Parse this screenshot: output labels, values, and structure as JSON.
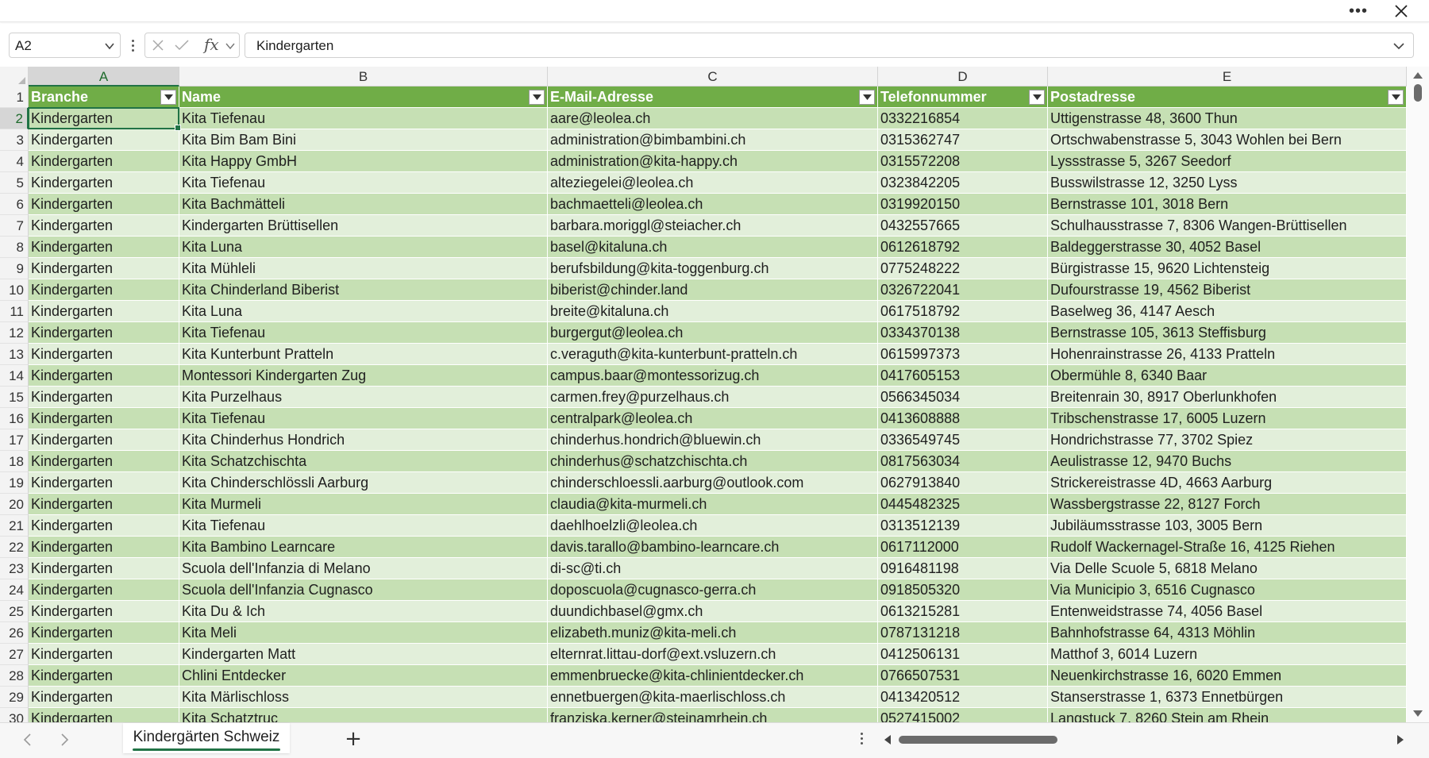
{
  "formula_bar": {
    "name_box": "A2",
    "formula": "Kindergarten"
  },
  "columns": [
    "A",
    "B",
    "C",
    "D",
    "E"
  ],
  "headers": [
    "Branche",
    "Name",
    "E-Mail-Adresse",
    "Telefonnummer",
    "Postadresse"
  ],
  "rows": [
    {
      "n": "2",
      "c": [
        "Kindergarten",
        "Kita Tiefenau",
        "aare@leolea.ch",
        "0332216854",
        "Uttigenstrasse 48, 3600 Thun"
      ]
    },
    {
      "n": "3",
      "c": [
        "Kindergarten",
        "Kita Bim Bam Bini",
        "administration@bimbambini.ch",
        "0315362747",
        "Ortschwabenstrasse 5, 3043 Wohlen bei Bern"
      ]
    },
    {
      "n": "4",
      "c": [
        "Kindergarten",
        "Kita Happy GmbH",
        "administration@kita-happy.ch",
        "0315572208",
        "Lyssstrasse 5, 3267 Seedorf"
      ]
    },
    {
      "n": "5",
      "c": [
        "Kindergarten",
        "Kita Tiefenau",
        "alteziegelei@leolea.ch",
        "0323842205",
        "Busswilstrasse 12, 3250 Lyss"
      ]
    },
    {
      "n": "6",
      "c": [
        "Kindergarten",
        "Kita Bachmätteli",
        "bachmaetteli@leolea.ch",
        "0319920150",
        "Bernstrasse 101, 3018 Bern"
      ]
    },
    {
      "n": "7",
      "c": [
        "Kindergarten",
        "Kindergarten Brüttisellen",
        "barbara.moriggl@steiacher.ch",
        "0432557665",
        "Schulhausstrasse 7, 8306 Wangen-Brüttisellen"
      ]
    },
    {
      "n": "8",
      "c": [
        "Kindergarten",
        "Kita Luna",
        "basel@kitaluna.ch",
        "0612618792",
        "Baldeggerstrasse 30, 4052 Basel"
      ]
    },
    {
      "n": "9",
      "c": [
        "Kindergarten",
        "Kita Mühleli",
        "berufsbildung@kita-toggenburg.ch",
        "0775248222",
        "Bürgistrasse 15, 9620 Lichtensteig"
      ]
    },
    {
      "n": "10",
      "c": [
        "Kindergarten",
        "Kita Chinderland Biberist",
        "biberist@chinder.land",
        "0326722041",
        "Dufourstrasse 19, 4562 Biberist"
      ]
    },
    {
      "n": "11",
      "c": [
        "Kindergarten",
        "Kita Luna",
        "breite@kitaluna.ch",
        "0617518792",
        "Baselweg 36, 4147 Aesch"
      ]
    },
    {
      "n": "12",
      "c": [
        "Kindergarten",
        "Kita Tiefenau",
        "burgergut@leolea.ch",
        "0334370138",
        "Bernstrasse 105, 3613 Steffisburg"
      ]
    },
    {
      "n": "13",
      "c": [
        "Kindergarten",
        "Kita Kunterbunt Pratteln",
        "c.veraguth@kita-kunterbunt-pratteln.ch",
        "0615997373",
        "Hohenrainstrasse 26, 4133 Pratteln"
      ]
    },
    {
      "n": "14",
      "c": [
        "Kindergarten",
        "Montessori Kindergarten Zug",
        "campus.baar@montessorizug.ch",
        "0417605153",
        "Obermühle 8, 6340 Baar"
      ]
    },
    {
      "n": "15",
      "c": [
        "Kindergarten",
        "Kita Purzelhaus",
        "carmen.frey@purzelhaus.ch",
        "0566345034",
        "Breitenrain 30, 8917 Oberlunkhofen"
      ]
    },
    {
      "n": "16",
      "c": [
        "Kindergarten",
        "Kita Tiefenau",
        "centralpark@leolea.ch",
        "0413608888",
        "Tribschenstrasse 17, 6005 Luzern"
      ]
    },
    {
      "n": "17",
      "c": [
        "Kindergarten",
        "Kita Chinderhus Hondrich",
        "chinderhus.hondrich@bluewin.ch",
        "0336549745",
        "Hondrichstrasse 77, 3702 Spiez"
      ]
    },
    {
      "n": "18",
      "c": [
        "Kindergarten",
        "Kita Schatzchischta",
        "chinderhus@schatzchischta.ch",
        "0817563034",
        "Aeulistrasse 12, 9470 Buchs"
      ]
    },
    {
      "n": "19",
      "c": [
        "Kindergarten",
        "Kita Chinderschlössli Aarburg",
        "chinderschloessli.aarburg@outlook.com",
        "0627913840",
        "Strickereistrasse 4D, 4663 Aarburg"
      ]
    },
    {
      "n": "20",
      "c": [
        "Kindergarten",
        "Kita Murmeli",
        "claudia@kita-murmeli.ch",
        "0445482325",
        "Wassbergstrasse 22, 8127 Forch"
      ]
    },
    {
      "n": "21",
      "c": [
        "Kindergarten",
        "Kita Tiefenau",
        "daehlhoelzli@leolea.ch",
        "0313512139",
        "Jubiläumsstrasse 103, 3005 Bern"
      ]
    },
    {
      "n": "22",
      "c": [
        "Kindergarten",
        "Kita Bambino Learncare",
        "davis.tarallo@bambino-learncare.ch",
        "0617112000",
        "Rudolf Wackernagel-Straße 16, 4125 Riehen"
      ]
    },
    {
      "n": "23",
      "c": [
        "Kindergarten",
        "Scuola dell'Infanzia di Melano",
        "di-sc@ti.ch",
        "0916481198",
        "Via Delle Scuole 5, 6818 Melano"
      ]
    },
    {
      "n": "24",
      "c": [
        "Kindergarten",
        "Scuola dell'Infanzia Cugnasco",
        "doposcuola@cugnasco-gerra.ch",
        "0918505320",
        "Via Municipio 3, 6516 Cugnasco"
      ]
    },
    {
      "n": "25",
      "c": [
        "Kindergarten",
        "Kita Du & Ich",
        "duundichbasel@gmx.ch",
        "0613215281",
        "Entenweidstrasse 74, 4056 Basel"
      ]
    },
    {
      "n": "26",
      "c": [
        "Kindergarten",
        "Kita Meli",
        "elizabeth.muniz@kita-meli.ch",
        "0787131218",
        "Bahnhofstrasse 64, 4313 Möhlin"
      ]
    },
    {
      "n": "27",
      "c": [
        "Kindergarten",
        "Kindergarten Matt",
        "elternrat.littau-dorf@ext.vsluzern.ch",
        "0412506131",
        "Matthof 3, 6014 Luzern"
      ]
    },
    {
      "n": "28",
      "c": [
        "Kindergarten",
        "Chlini Entdecker",
        "emmenbruecke@kita-chlinientdecker.ch",
        "0766507531",
        "Neuenkirchstrasse 16, 6020 Emmen"
      ]
    },
    {
      "n": "29",
      "c": [
        "Kindergarten",
        "Kita Märlischloss",
        "ennetbuergen@kita-maerlischloss.ch",
        "0413420512",
        "Stanserstrasse 1, 6373 Ennetbürgen"
      ]
    },
    {
      "n": "30",
      "c": [
        "Kindergarten",
        "Kita Schatztruc",
        "franziska.kerner@steinamrhein.ch",
        "0527415002",
        "Langstuck 7, 8260 Stein am Rhein"
      ]
    }
  ],
  "sheet_tab": "Kindergärten Schweiz",
  "colors": {
    "header_fill": "#70ad47",
    "band_dark": "#c6e0b4",
    "band_light": "#e2efda",
    "selection": "#217346"
  }
}
